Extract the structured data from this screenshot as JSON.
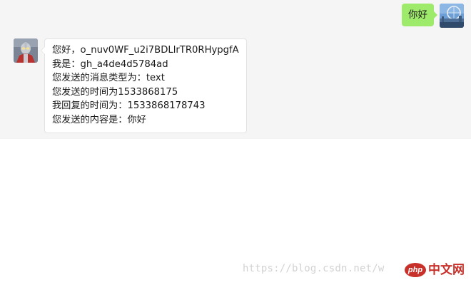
{
  "conversation": {
    "outgoing": {
      "text": "你好"
    },
    "incoming": {
      "lines": [
        "您好，o_nuv0WF_u2i7BDLlrTR0RHypgfA",
        "我是：gh_a4de4d5784ad",
        "您发送的消息类型为：text",
        "您发送的时间为1533868175",
        "我回复的时间为：1533868178743",
        "您发送的内容是：你好"
      ]
    }
  },
  "watermark": {
    "url_text": "https://blog.csdn.net/w",
    "logo_badge": "php",
    "logo_text": "中文网"
  },
  "colors": {
    "chat_background": "#f5f5f5",
    "outgoing_bubble": "#9eea6a",
    "incoming_bubble": "#ffffff",
    "logo_red": "#c7312a"
  },
  "icons": {
    "user_avatar": "landscape-photo-avatar",
    "bot_avatar": "ultraman-avatar"
  }
}
